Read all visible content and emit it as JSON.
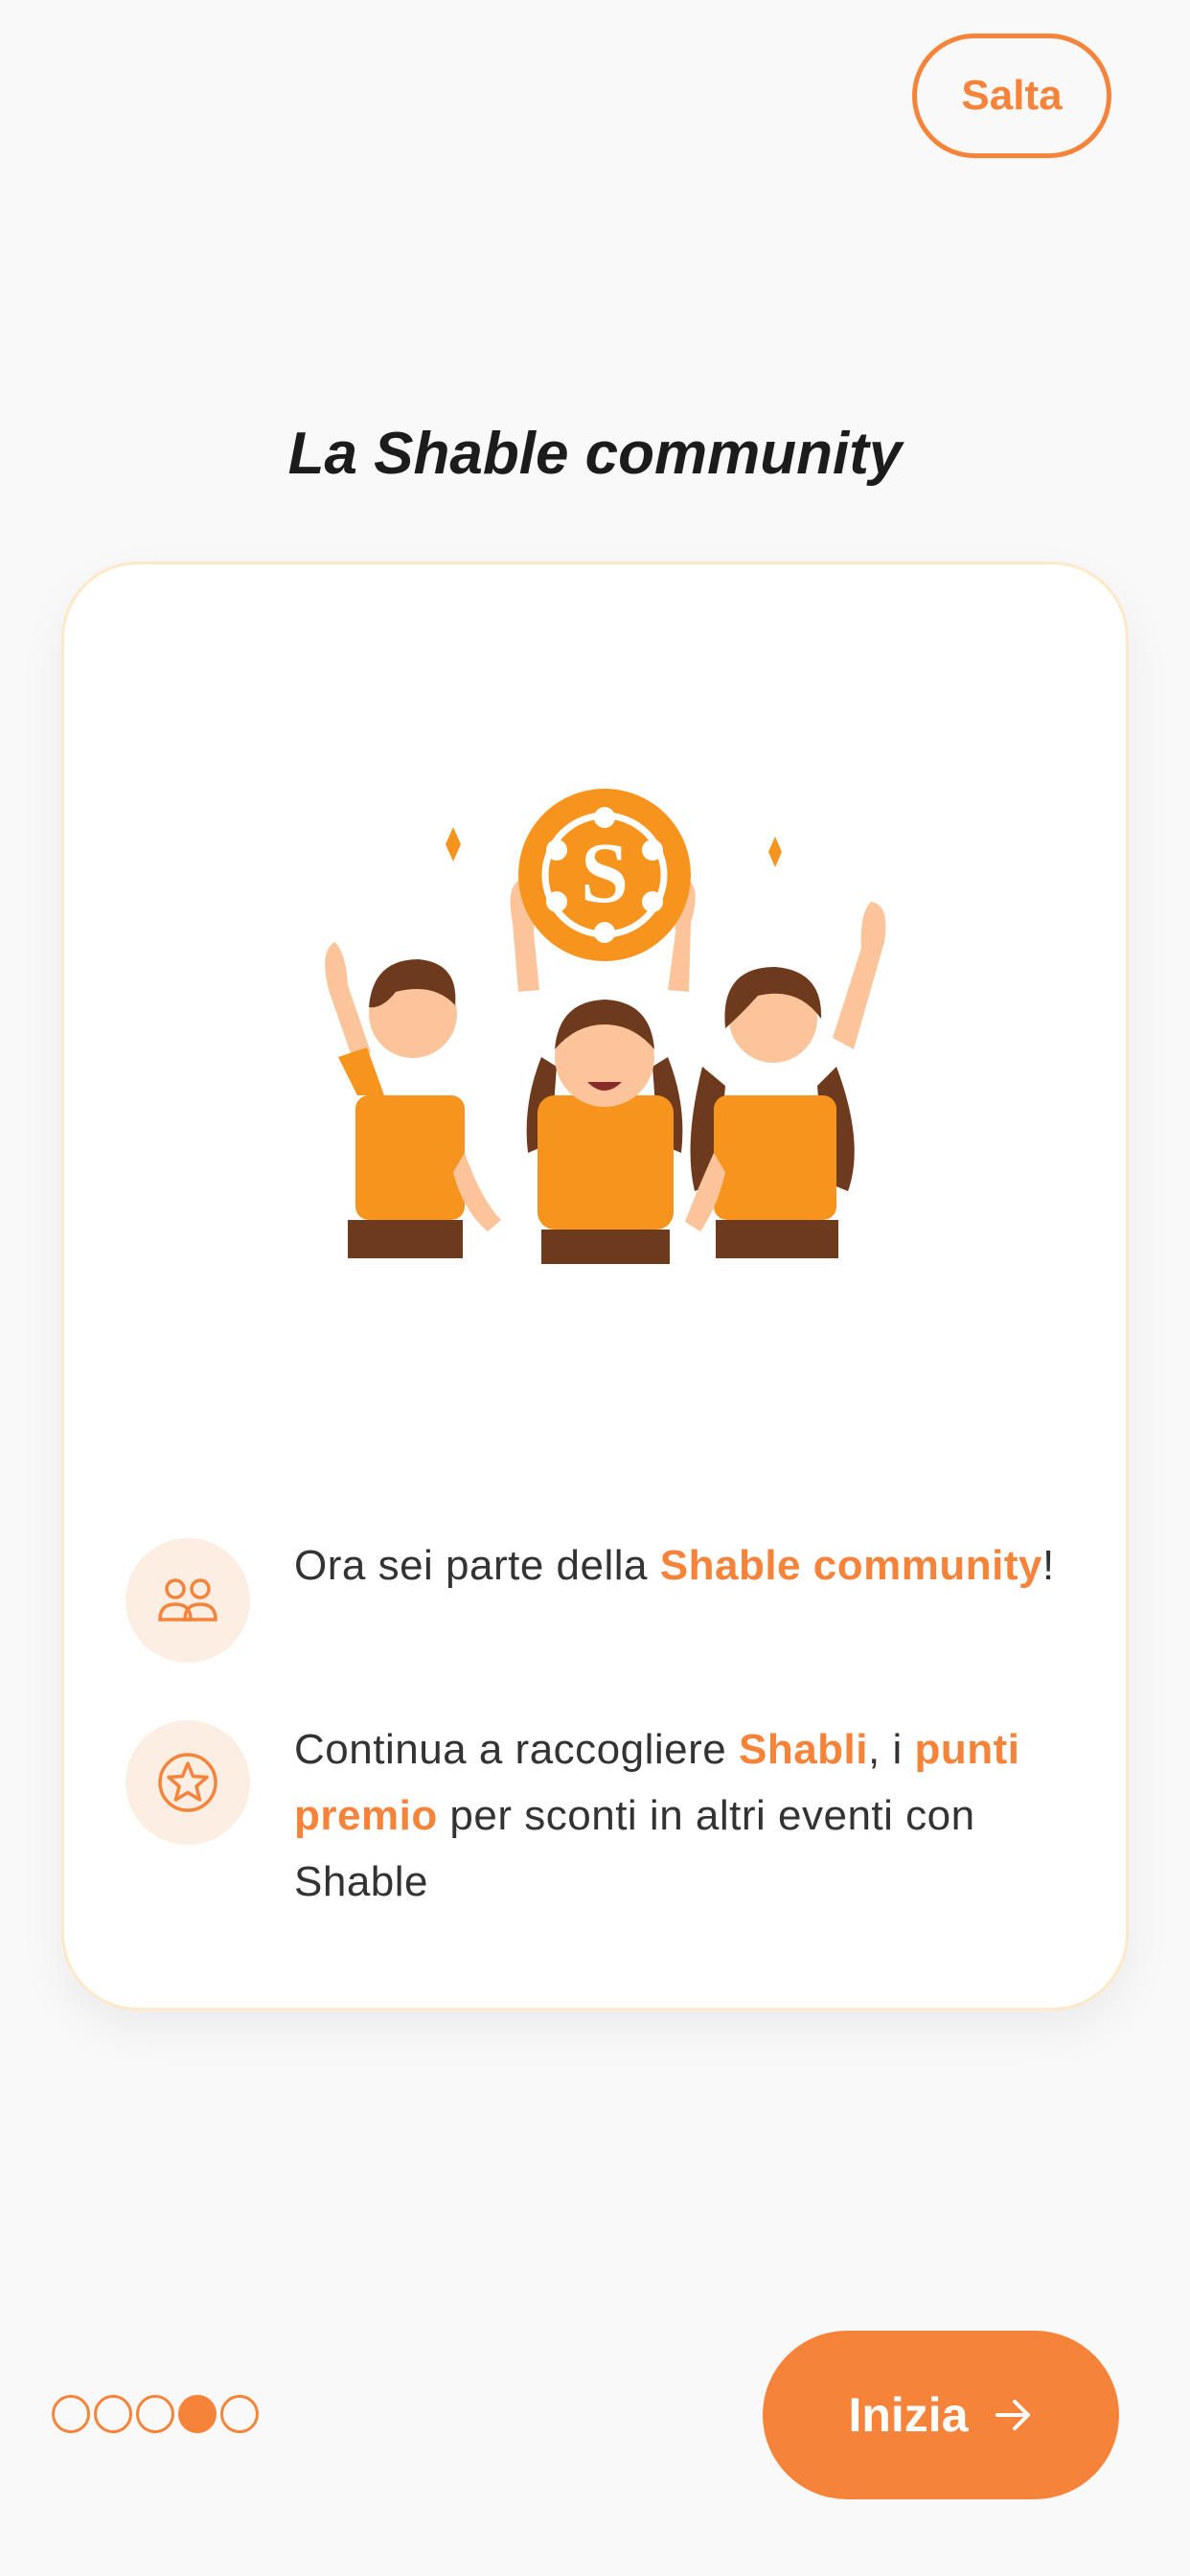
{
  "header": {
    "skip_label": "Salta"
  },
  "title": "La Shable community",
  "features": [
    {
      "icon": "people-icon",
      "pre": "Ora sei parte della ",
      "bold1": "Shable community",
      "post": "!"
    },
    {
      "icon": "star-badge-icon",
      "pre": "Continua a raccogliere ",
      "bold1": "Shabli",
      "mid": ", i ",
      "bold2": "punti premio",
      "post": " per sconti in altri eventi con Shable"
    }
  ],
  "pagination": {
    "total": 5,
    "current": 4
  },
  "footer": {
    "start_label": "Inizia",
    "start_icon": "arrow-right-icon"
  },
  "colors": {
    "accent": "#f5843a",
    "icon_bg": "#fdeee4",
    "text": "#333333",
    "title": "#1c1c1c"
  }
}
